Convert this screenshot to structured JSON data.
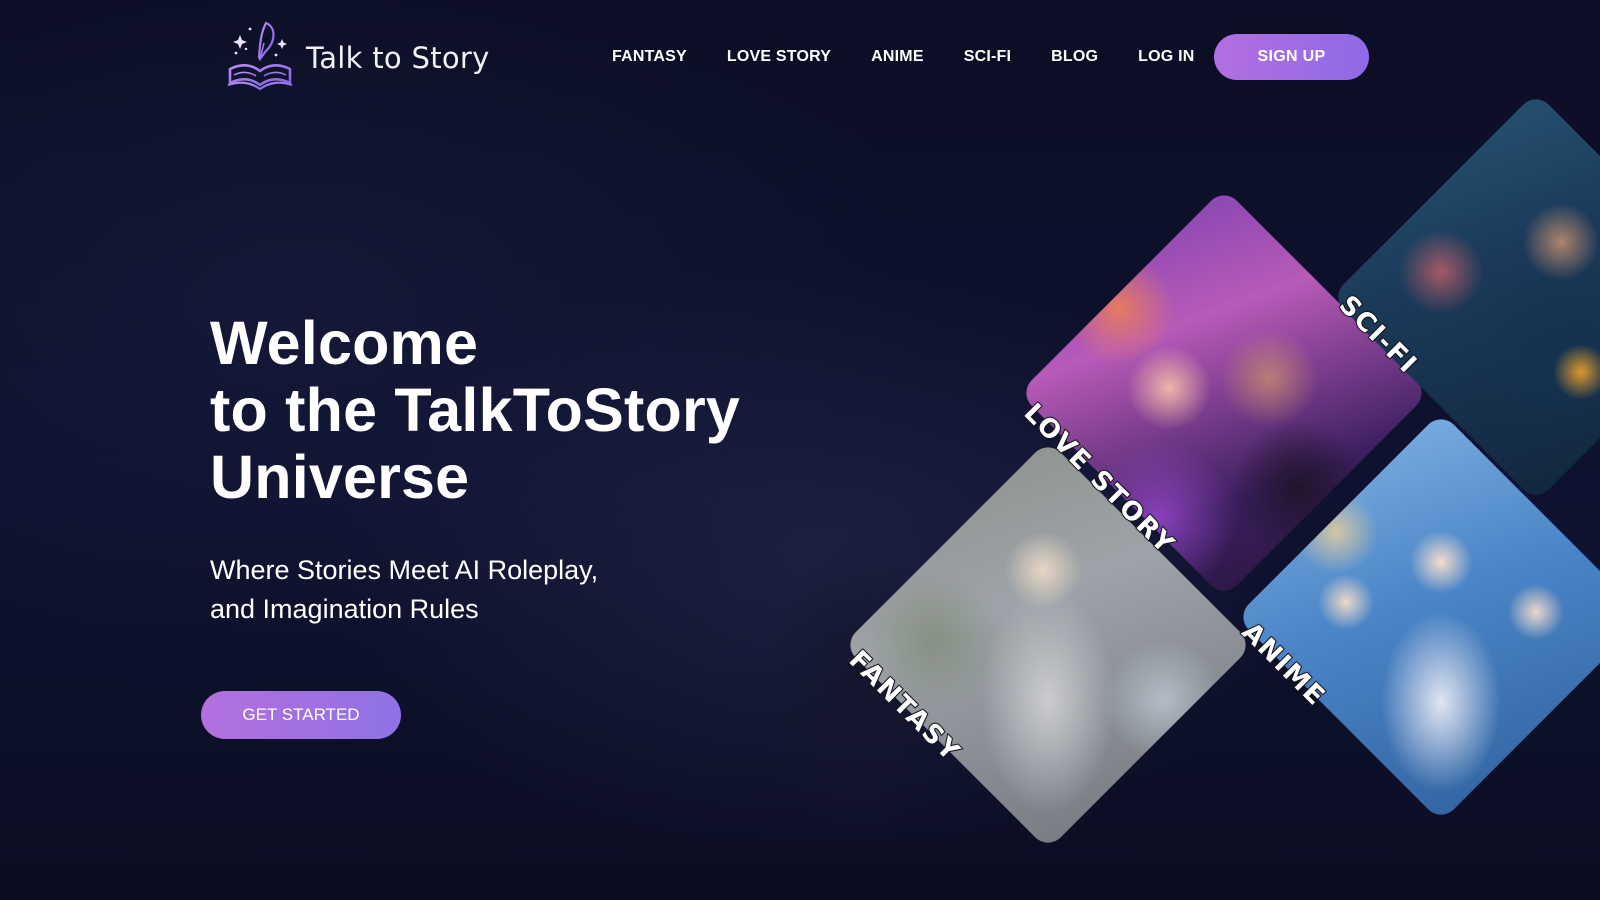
{
  "brand": {
    "name": "Talk to Story",
    "accent": "#9b6ce6",
    "background": "#0c0f26"
  },
  "nav": {
    "links": [
      "FANTASY",
      "LOVE STORY",
      "ANIME",
      "SCI-FI",
      "BLOG",
      "LOG IN"
    ],
    "signup_label": "SIGN UP"
  },
  "hero": {
    "title_lines": [
      "Welcome",
      "to the TalkToStory",
      "Universe"
    ],
    "subtitle_lines": [
      "Where Stories Meet AI Roleplay,",
      "and Imagination Rules"
    ],
    "cta_label": "GET STARTED"
  },
  "categories": [
    {
      "label": "LOVE STORY",
      "icon": "couple-illustration"
    },
    {
      "label": "SCI-FI",
      "icon": "cyborg-illustration"
    },
    {
      "label": "FANTASY",
      "icon": "elf-illustration"
    },
    {
      "label": "ANIME",
      "icon": "anime-group-illustration"
    }
  ]
}
